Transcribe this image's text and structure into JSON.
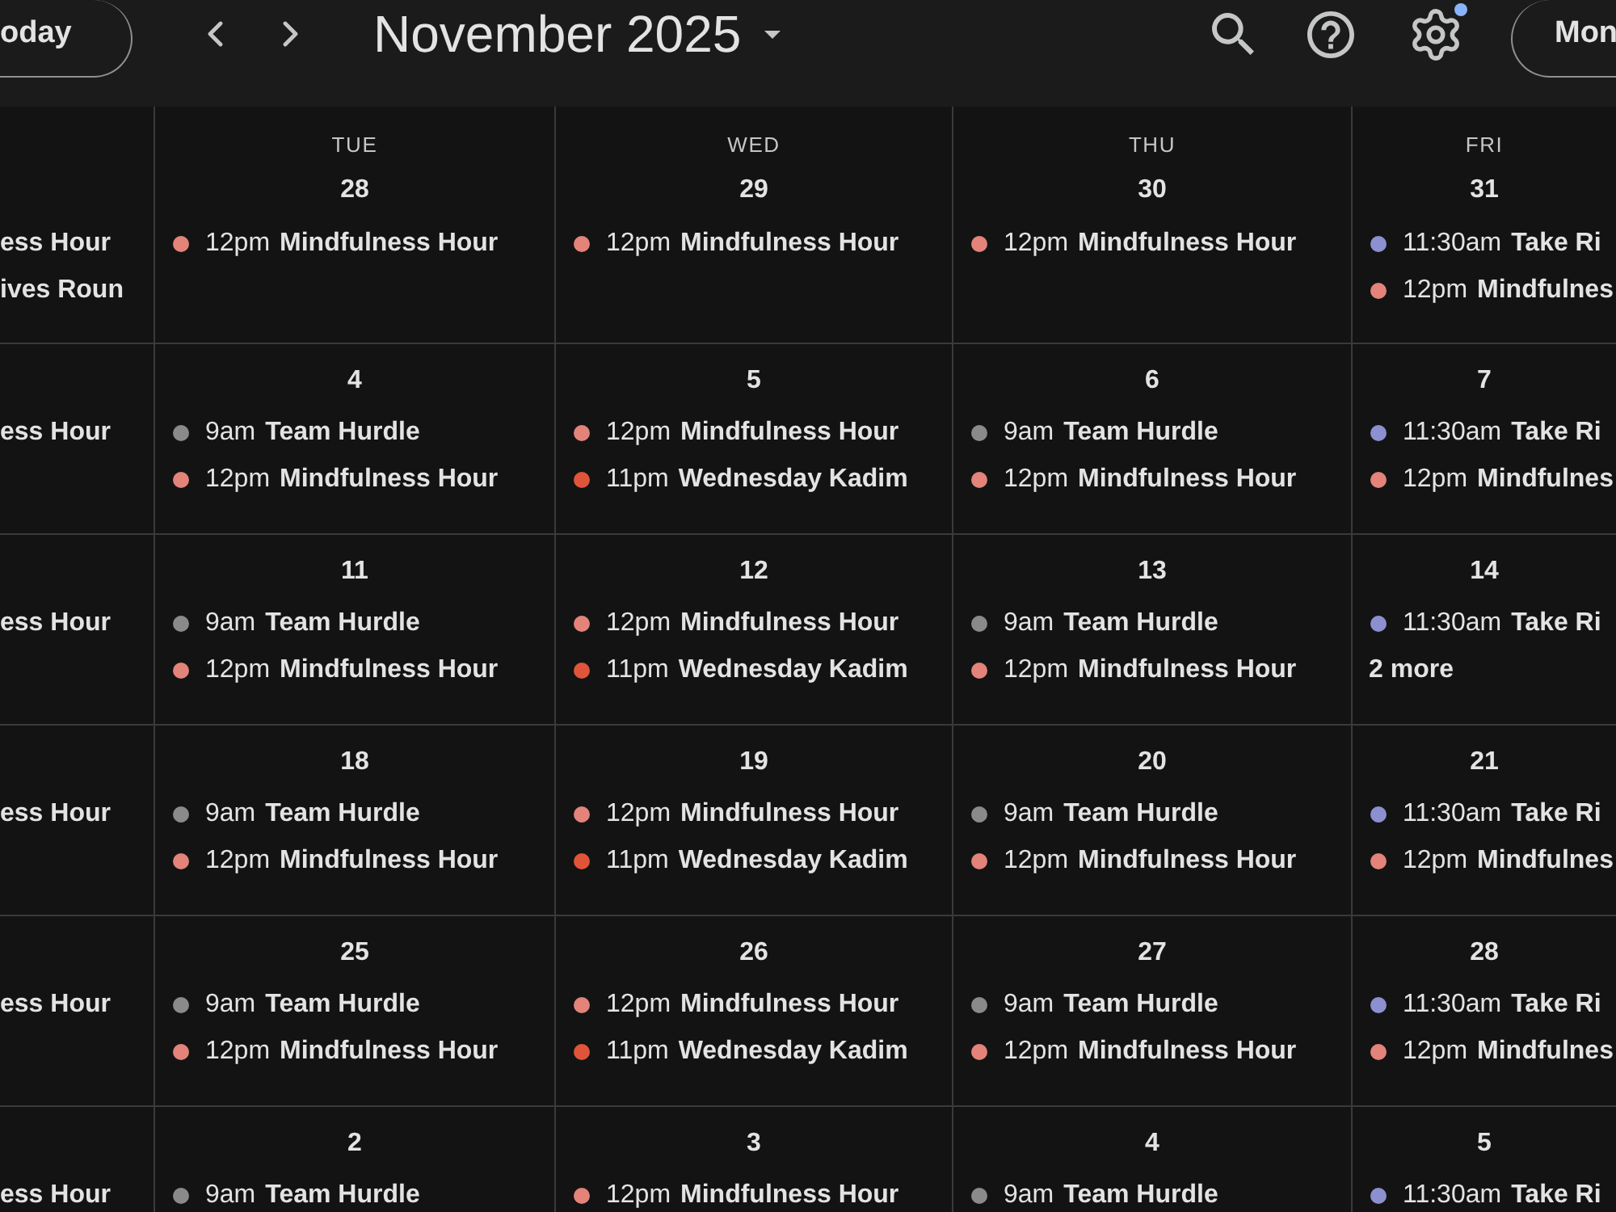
{
  "toolbar": {
    "today_button": "oday",
    "title": "November 2025",
    "settings_badge": true,
    "view_button": "Mon"
  },
  "weeks": [
    {
      "days": [
        {
          "events": [
            {
              "title": "ess Hour"
            },
            {
              "title": "ives Roun"
            }
          ]
        },
        {
          "day_name": "TUE",
          "date": "28",
          "events": [
            {
              "time": "12pm",
              "title": "Mindfulness Hour",
              "color": "#e3837a"
            }
          ]
        },
        {
          "day_name": "WED",
          "date": "29",
          "events": [
            {
              "time": "12pm",
              "title": "Mindfulness Hour",
              "color": "#e3837a"
            }
          ]
        },
        {
          "day_name": "THU",
          "date": "30",
          "events": [
            {
              "time": "12pm",
              "title": "Mindfulness Hour",
              "color": "#e3837a"
            }
          ]
        },
        {
          "day_name": "FRI",
          "date": "31",
          "events": [
            {
              "time": "11:30am",
              "title": "Take Ri",
              "color": "#8c90d0"
            },
            {
              "time": "12pm",
              "title": "Mindfulnes",
              "color": "#e3837a"
            }
          ]
        }
      ]
    },
    {
      "days": [
        {
          "events": [
            {
              "title": "ess Hour"
            }
          ]
        },
        {
          "date": "4",
          "events": [
            {
              "time": "9am",
              "title": "Team Hurdle",
              "color": "#8a8a8a"
            },
            {
              "time": "12pm",
              "title": "Mindfulness Hour",
              "color": "#e3837a"
            }
          ]
        },
        {
          "date": "5",
          "events": [
            {
              "time": "12pm",
              "title": "Mindfulness Hour",
              "color": "#e3837a"
            },
            {
              "time": "11pm",
              "title": "Wednesday Kadim",
              "color": "#e0553a"
            }
          ]
        },
        {
          "date": "6",
          "events": [
            {
              "time": "9am",
              "title": "Team Hurdle",
              "color": "#8a8a8a"
            },
            {
              "time": "12pm",
              "title": "Mindfulness Hour",
              "color": "#e3837a"
            }
          ]
        },
        {
          "date": "7",
          "events": [
            {
              "time": "11:30am",
              "title": "Take Ri",
              "color": "#8c90d0"
            },
            {
              "time": "12pm",
              "title": "Mindfulnes",
              "color": "#e3837a"
            }
          ]
        }
      ]
    },
    {
      "days": [
        {
          "events": [
            {
              "title": "ess Hour"
            }
          ]
        },
        {
          "date": "11",
          "events": [
            {
              "time": "9am",
              "title": "Team Hurdle",
              "color": "#8a8a8a"
            },
            {
              "time": "12pm",
              "title": "Mindfulness Hour",
              "color": "#e3837a"
            }
          ]
        },
        {
          "date": "12",
          "events": [
            {
              "time": "12pm",
              "title": "Mindfulness Hour",
              "color": "#e3837a"
            },
            {
              "time": "11pm",
              "title": "Wednesday Kadim",
              "color": "#e0553a"
            }
          ]
        },
        {
          "date": "13",
          "events": [
            {
              "time": "9am",
              "title": "Team Hurdle",
              "color": "#8a8a8a"
            },
            {
              "time": "12pm",
              "title": "Mindfulness Hour",
              "color": "#e3837a"
            }
          ]
        },
        {
          "date": "14",
          "events": [
            {
              "time": "11:30am",
              "title": "Take Ri",
              "color": "#8c90d0"
            }
          ],
          "more": "2 more"
        }
      ]
    },
    {
      "days": [
        {
          "events": [
            {
              "title": "ess Hour"
            }
          ]
        },
        {
          "date": "18",
          "events": [
            {
              "time": "9am",
              "title": "Team Hurdle",
              "color": "#8a8a8a"
            },
            {
              "time": "12pm",
              "title": "Mindfulness Hour",
              "color": "#e3837a"
            }
          ]
        },
        {
          "date": "19",
          "events": [
            {
              "time": "12pm",
              "title": "Mindfulness Hour",
              "color": "#e3837a"
            },
            {
              "time": "11pm",
              "title": "Wednesday Kadim",
              "color": "#e0553a"
            }
          ]
        },
        {
          "date": "20",
          "events": [
            {
              "time": "9am",
              "title": "Team Hurdle",
              "color": "#8a8a8a"
            },
            {
              "time": "12pm",
              "title": "Mindfulness Hour",
              "color": "#e3837a"
            }
          ]
        },
        {
          "date": "21",
          "events": [
            {
              "time": "11:30am",
              "title": "Take Ri",
              "color": "#8c90d0"
            },
            {
              "time": "12pm",
              "title": "Mindfulnes",
              "color": "#e3837a"
            }
          ]
        }
      ]
    },
    {
      "days": [
        {
          "events": [
            {
              "title": "ess Hour"
            }
          ]
        },
        {
          "date": "25",
          "events": [
            {
              "time": "9am",
              "title": "Team Hurdle",
              "color": "#8a8a8a"
            },
            {
              "time": "12pm",
              "title": "Mindfulness Hour",
              "color": "#e3837a"
            }
          ]
        },
        {
          "date": "26",
          "events": [
            {
              "time": "12pm",
              "title": "Mindfulness Hour",
              "color": "#e3837a"
            },
            {
              "time": "11pm",
              "title": "Wednesday Kadim",
              "color": "#e0553a"
            }
          ]
        },
        {
          "date": "27",
          "events": [
            {
              "time": "9am",
              "title": "Team Hurdle",
              "color": "#8a8a8a"
            },
            {
              "time": "12pm",
              "title": "Mindfulness Hour",
              "color": "#e3837a"
            }
          ]
        },
        {
          "date": "28",
          "events": [
            {
              "time": "11:30am",
              "title": "Take Ri",
              "color": "#8c90d0"
            },
            {
              "time": "12pm",
              "title": "Mindfulnes",
              "color": "#e3837a"
            }
          ]
        }
      ]
    },
    {
      "days": [
        {
          "events": [
            {
              "title": "ess Hour"
            }
          ]
        },
        {
          "date": "2",
          "events": [
            {
              "time": "9am",
              "title": "Team Hurdle",
              "color": "#8a8a8a"
            }
          ]
        },
        {
          "date": "3",
          "events": [
            {
              "time": "12pm",
              "title": "Mindfulness Hour",
              "color": "#e3837a"
            }
          ]
        },
        {
          "date": "4",
          "events": [
            {
              "time": "9am",
              "title": "Team Hurdle",
              "color": "#8a8a8a"
            }
          ]
        },
        {
          "date": "5",
          "events": [
            {
              "time": "11:30am",
              "title": "Take Ri",
              "color": "#8c90d0"
            }
          ]
        }
      ]
    }
  ]
}
